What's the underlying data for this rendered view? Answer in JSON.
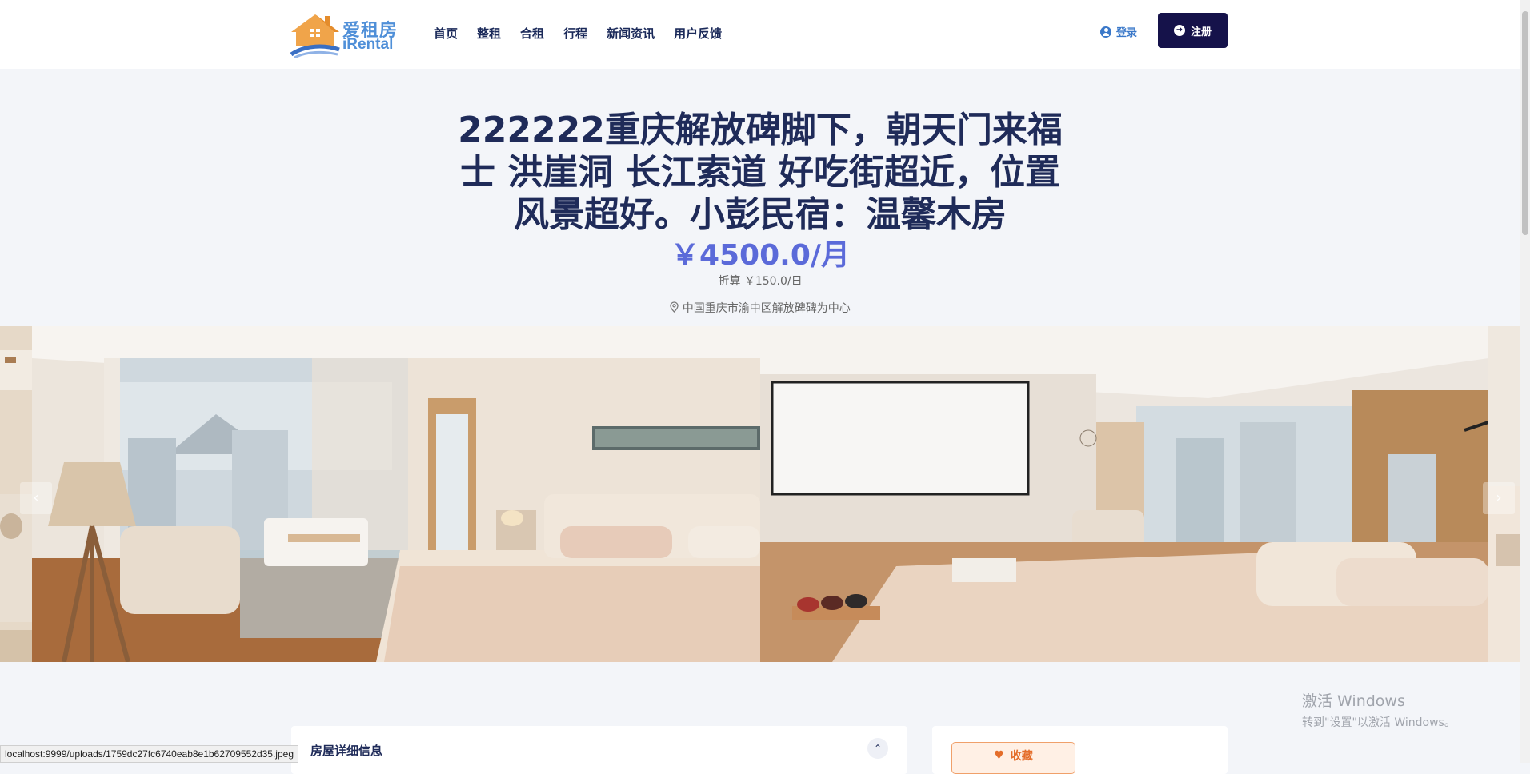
{
  "brand": {
    "name_cn": "爱租房",
    "name_en": "iRental"
  },
  "nav": {
    "items": [
      {
        "label": "首页"
      },
      {
        "label": "整租"
      },
      {
        "label": "合租"
      },
      {
        "label": "行程"
      },
      {
        "label": "新闻资讯"
      },
      {
        "label": "用户反馈"
      }
    ]
  },
  "auth": {
    "login_label": "登录",
    "register_label": "注册"
  },
  "listing": {
    "title": "222222重庆解放碑脚下，朝天门来福士 洪崖洞 长江索道 好吃街超近，位置风景超好。小彭民宿：温馨木房",
    "price": "￥4500.0/月",
    "per_day": "折算 ￥150.0/日",
    "address": "中国重庆市渝中区解放碑碑为中心"
  },
  "gallery": {
    "prev_icon": "chevron-left-icon",
    "next_icon": "chevron-right-icon"
  },
  "details": {
    "title": "房屋详细信息"
  },
  "sidebar": {
    "favorite_label": "收藏"
  },
  "windows_watermark": {
    "line1": "激活 Windows",
    "line2": "转到\"设置\"以激活 Windows。"
  },
  "status_url": "localhost:9999/uploads/1759dc27fc6740eab8e1b62709552d35.jpeg",
  "colors": {
    "navy": "#1f2b59",
    "accent": "#5b6ad9",
    "button_dark": "#15124a",
    "favorite": "#e46d2a"
  }
}
